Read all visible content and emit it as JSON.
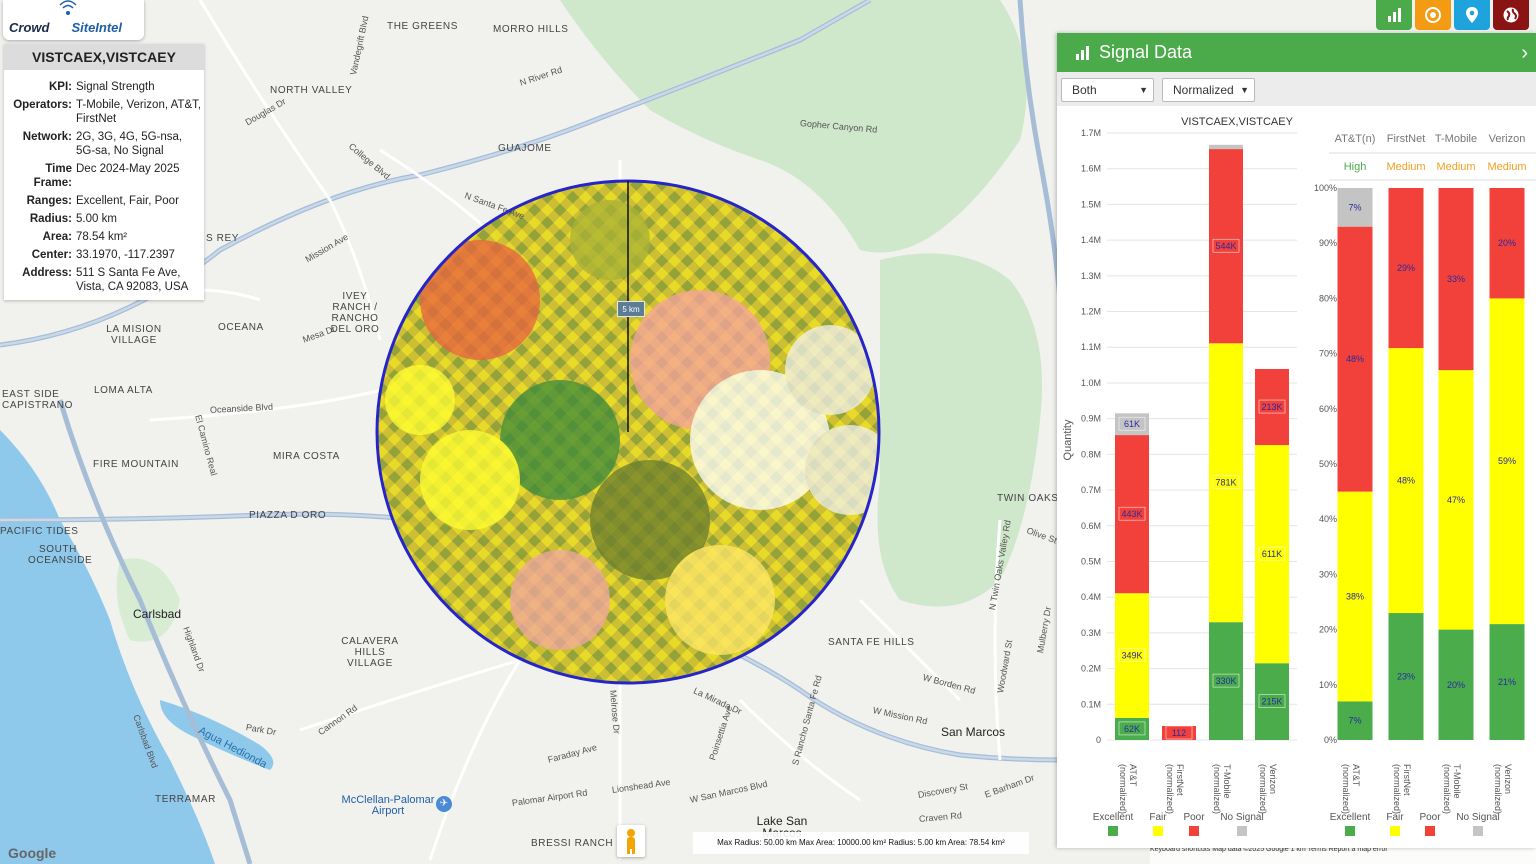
{
  "logo": {
    "text_a": "Crowd",
    "text_b": "SiteIntel"
  },
  "info": {
    "title": "VISTCAEX,VISTCAEY",
    "rows": [
      {
        "k": "KPI:",
        "v": "Signal Strength"
      },
      {
        "k": "Operators:",
        "v": "T-Mobile, Verizon, AT&T, FirstNet"
      },
      {
        "k": "Network:",
        "v": "2G, 3G, 4G, 5G-nsa, 5G-sa, No Signal"
      },
      {
        "k": "Time Frame:",
        "v": "Dec 2024-May 2025"
      },
      {
        "k": "Ranges:",
        "v": "Excellent, Fair, Poor"
      },
      {
        "k": "Radius:",
        "v": "5.00 km"
      },
      {
        "k": "Area:",
        "v": "78.54 km²"
      },
      {
        "k": "Center:",
        "v": "33.1970, -117.2397"
      },
      {
        "k": "Address:",
        "v": "511 S Santa Fe Ave, Vista, CA 92083, USA"
      }
    ]
  },
  "map": {
    "radius_label": "5 km",
    "max_box": "Max Radius: 50.00 km Max Area: 10000.00 km² Radius: 5.00 km Area: 78.54 km²",
    "google": "Google",
    "attribution": "Keyboard shortcuts    Map data ©2025 Google    1 km    Terms    Report a map error",
    "places": [
      {
        "t": "THE GREENS"
      },
      {
        "t": "MORRO HILLS"
      },
      {
        "t": "NORTH VALLEY"
      },
      {
        "t": "GUAJOME"
      },
      {
        "t": "IVEY RANCH / RANCHO DEL ORO"
      },
      {
        "t": "OCEANA"
      },
      {
        "t": "LA MISION VILLAGE"
      },
      {
        "t": "LOMA ALTA"
      },
      {
        "t": "EAST SIDE CAPISTRANO"
      },
      {
        "t": "FIRE MOUNTAIN"
      },
      {
        "t": "MIRA COSTA"
      },
      {
        "t": "PIAZZA D ORO"
      },
      {
        "t": "PACIFIC TIDES"
      },
      {
        "t": "SOUTH OCEANSIDE"
      },
      {
        "t": "CALAVERA HILLS VILLAGE"
      },
      {
        "t": "TERRAMAR"
      },
      {
        "t": "BRESSI RANCH"
      },
      {
        "t": "SANTA FE HILLS"
      },
      {
        "t": "TWIN OAKS"
      },
      {
        "t": "S REY"
      }
    ],
    "cities": [
      {
        "t": "Carlsbad"
      },
      {
        "t": "San Marcos"
      },
      {
        "t": "Lake San Marcos"
      },
      {
        "t": "McClellan-Palomar Airport"
      }
    ],
    "roads": [
      {
        "t": "Vandegrift Blvd"
      },
      {
        "t": "N River Rd"
      },
      {
        "t": "Douglas Dr"
      },
      {
        "t": "College Blvd"
      },
      {
        "t": "Mission Ave"
      },
      {
        "t": "Mesa Dr"
      },
      {
        "t": "Oceanside Blvd"
      },
      {
        "t": "El Camino Real"
      },
      {
        "t": "Gopher Canyon Rd"
      },
      {
        "t": "Olive St"
      },
      {
        "t": "W Borden Rd"
      },
      {
        "t": "W Mission Rd"
      },
      {
        "t": "La Mirada Dr"
      },
      {
        "t": "Faraday Ave"
      },
      {
        "t": "Palomar Airport Rd"
      },
      {
        "t": "Cannon Rd"
      },
      {
        "t": "Park Dr"
      },
      {
        "t": "Agua Hedionda"
      },
      {
        "t": "W San Marcos Blvd"
      },
      {
        "t": "Discovery St"
      },
      {
        "t": "Craven Rd"
      },
      {
        "t": "E Barham Dr"
      },
      {
        "t": "Lionshead Ave"
      },
      {
        "t": "N Santa Fe Ave"
      },
      {
        "t": "Melrose Dr"
      },
      {
        "t": "N Twin Oaks Valley Rd"
      },
      {
        "t": "Mulberry Dr"
      },
      {
        "t": "Woodward St"
      },
      {
        "t": "S Rancho Santa Fe Rd"
      },
      {
        "t": "Poinsettia Ave"
      },
      {
        "t": "Highland Dr"
      },
      {
        "t": "Carlsbad Blvd"
      }
    ]
  },
  "toolbar": {
    "icons": [
      "bar-chart-icon",
      "target-icon",
      "location-pin-icon",
      "globe-icon"
    ]
  },
  "panel": {
    "title": "Signal Data",
    "select_operator": "Both",
    "select_mode": "Normalized",
    "chart_title": "VISTCAEX,VISTCAEY",
    "legend": [
      "Excellent",
      "Fair",
      "Poor",
      "No Signal"
    ],
    "colors": {
      "excellent": "#4aac4a",
      "fair": "#ffff00",
      "poor": "#f2413a",
      "nosignal": "#c4c4c4",
      "accent": "#4bab4b"
    },
    "table": {
      "headers": [
        "AT&T(n)",
        "FirstNet",
        "T-Mobile",
        "Verizon"
      ],
      "ratings": [
        "High",
        "Medium",
        "Medium",
        "Medium"
      ]
    }
  },
  "chart_data": [
    {
      "type": "bar",
      "stacked": true,
      "title": "VISTCAEX,VISTCAEY",
      "ylabel": "Quantity",
      "ylim": [
        0,
        1700000
      ],
      "y_ticks": [
        "0",
        "0.1M",
        "0.2M",
        "0.3M",
        "0.4M",
        "0.5M",
        "0.6M",
        "0.7M",
        "0.8M",
        "0.9M",
        "1.0M",
        "1.1M",
        "1.2M",
        "1.3M",
        "1.4M",
        "1.5M",
        "1.6M",
        "1.7M"
      ],
      "categories": [
        "AT&T (normalized)",
        "FirstNet (normalized)",
        "T-Mobile (normalized)",
        "Verizon (normalized)"
      ],
      "series": [
        {
          "name": "Excellent",
          "values": [
            62000,
            0,
            330000,
            215000
          ],
          "labels": [
            "62K",
            "",
            "330K",
            "215K"
          ]
        },
        {
          "name": "Fair",
          "values": [
            349000,
            0,
            781000,
            611000
          ],
          "labels": [
            "349K",
            "",
            "781K",
            "611K"
          ]
        },
        {
          "name": "Poor",
          "values": [
            443000,
            112,
            544000,
            213000
          ],
          "labels": [
            "443K",
            "112",
            "544K",
            "213K"
          ]
        },
        {
          "name": "No Signal",
          "values": [
            61000,
            0,
            12000,
            0
          ],
          "labels": [
            "61K",
            "",
            "",
            ""
          ]
        }
      ]
    },
    {
      "type": "bar",
      "stacked": true,
      "ylim": [
        0,
        100
      ],
      "y_ticks": [
        "0%",
        "10%",
        "20%",
        "30%",
        "40%",
        "50%",
        "60%",
        "70%",
        "80%",
        "90%",
        "100%"
      ],
      "categories": [
        "AT&T (normalized)",
        "FirstNet (normalized)",
        "T-Mobile (normalized)",
        "Verizon (normalized)"
      ],
      "series": [
        {
          "name": "Excellent",
          "values": [
            7,
            23,
            20,
            21
          ],
          "labels": [
            "7%",
            "23%",
            "20%",
            "21%"
          ]
        },
        {
          "name": "Fair",
          "values": [
            38,
            48,
            47,
            59
          ],
          "labels": [
            "38%",
            "48%",
            "47%",
            "59%"
          ]
        },
        {
          "name": "Poor",
          "values": [
            48,
            29,
            33,
            20
          ],
          "labels": [
            "48%",
            "29%",
            "33%",
            "20%"
          ]
        },
        {
          "name": "No Signal",
          "values": [
            7,
            0,
            0,
            0
          ],
          "labels": [
            "7%",
            "",
            "",
            ""
          ]
        }
      ]
    }
  ]
}
